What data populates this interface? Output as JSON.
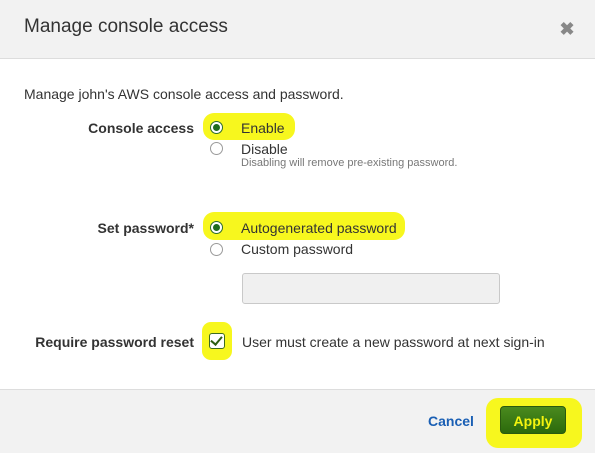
{
  "dialog": {
    "title": "Manage console access",
    "close_icon": "close-icon"
  },
  "intro": "Manage john's AWS console access and password.",
  "console_access": {
    "label": "Console access",
    "options": [
      {
        "label": "Enable",
        "selected": true
      },
      {
        "label": "Disable",
        "selected": false,
        "hint": "Disabling will remove pre-existing password."
      }
    ]
  },
  "set_password": {
    "label": "Set password*",
    "options": [
      {
        "label": "Autogenerated password",
        "selected": true
      },
      {
        "label": "Custom password",
        "selected": false
      }
    ],
    "custom_value": ""
  },
  "require_reset": {
    "label": "Require password reset",
    "checked": true,
    "text": "User must create a new password at next sign-in"
  },
  "footer": {
    "cancel_label": "Cancel",
    "apply_label": "Apply"
  },
  "colors": {
    "highlight": "#f7f71e",
    "apply_button": "#3b7a16",
    "link": "#1a5fb4"
  }
}
